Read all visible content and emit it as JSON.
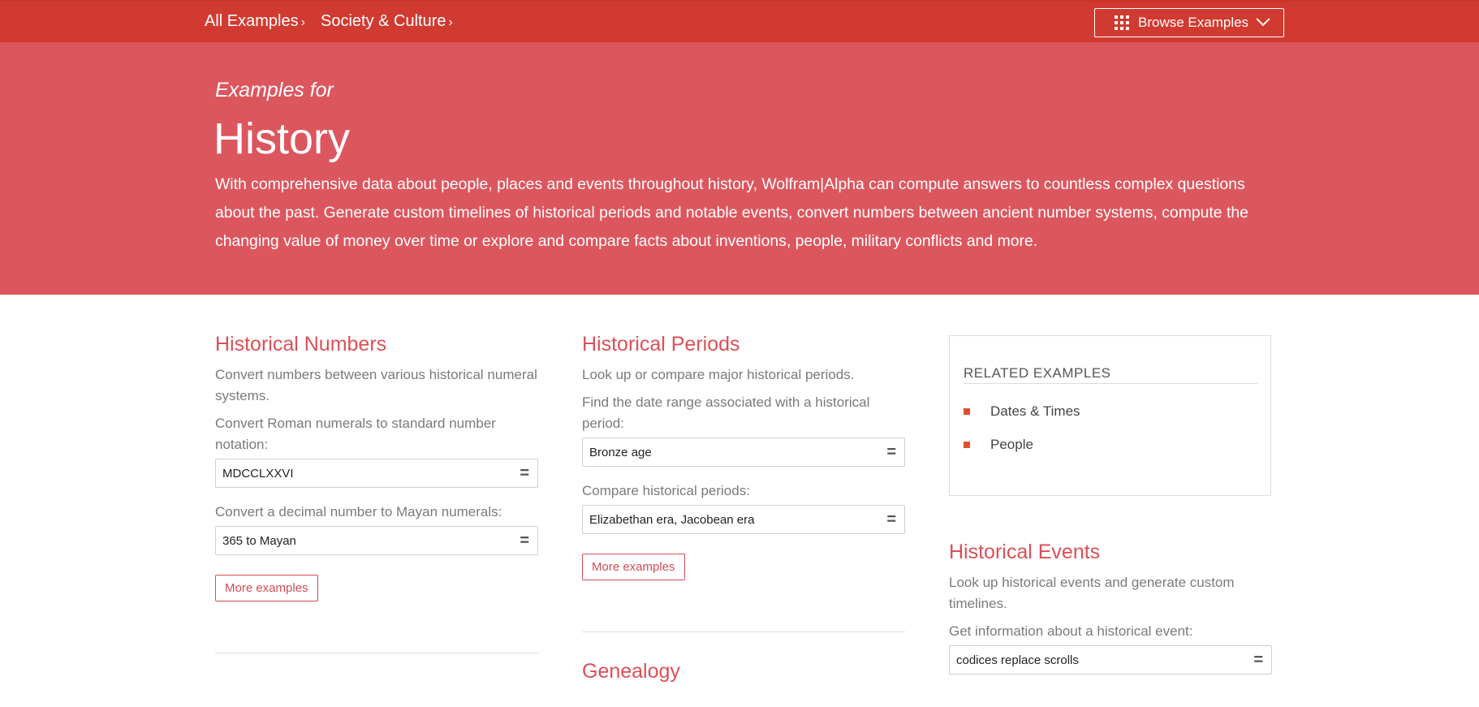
{
  "nav": {
    "crumbs": [
      "All Examples",
      "Society & Culture"
    ],
    "chevron": "›",
    "browse_label": "Browse Examples"
  },
  "hero": {
    "subtitle": "Examples for",
    "title": "History",
    "description": "With comprehensive data about people, places and events throughout history, Wolfram|Alpha can compute answers to countless complex questions about the past. Generate custom timelines of historical periods and notable events, convert numbers between ancient number systems, compute the changing value of money over time or explore and compare facts about inventions, people, military conflicts and more."
  },
  "sections": {
    "numbers": {
      "title": "Historical Numbers",
      "desc": "Convert numbers between various historical numeral systems.",
      "examples": [
        {
          "label": "Convert Roman numerals to standard number notation:",
          "query": "MDCCLXXVI"
        },
        {
          "label": "Convert a decimal number to Mayan numerals:",
          "query": "365 to Mayan"
        }
      ],
      "more": "More examples"
    },
    "periods": {
      "title": "Historical Periods",
      "desc": "Look up or compare major historical periods.",
      "examples": [
        {
          "label": "Find the date range associated with a historical period:",
          "query": "Bronze age"
        },
        {
          "label": "Compare historical periods:",
          "query": "Elizabethan era, Jacobean era"
        }
      ],
      "more": "More examples"
    },
    "genealogy": {
      "title": "Genealogy"
    },
    "events": {
      "title": "Historical Events",
      "desc": "Look up historical events and generate custom timelines.",
      "examples": [
        {
          "label": "Get information about a historical event:",
          "query": "codices replace scrolls"
        }
      ]
    }
  },
  "related": {
    "heading": "RELATED EXAMPLES",
    "items": [
      "Dates & Times",
      "People"
    ]
  },
  "icons": {
    "equals": "="
  },
  "colors": {
    "nav": "#d13a30",
    "hero": "#dc565e",
    "accent": "#dc4f56",
    "bullet": "#e0502b"
  }
}
